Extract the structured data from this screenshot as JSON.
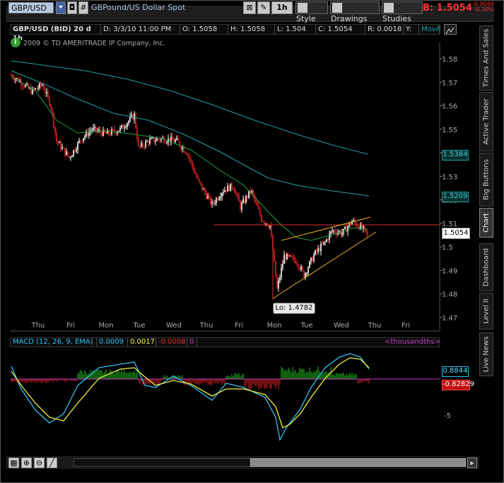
{
  "toolbar": {
    "symbol": "GBP/USD",
    "description": "GBPound/US Dollar Spot",
    "timeframe": "1h",
    "style_label": "Style",
    "drawings_label": "Drawings",
    "studies_label": "Studies",
    "last_prefix": "B:",
    "last_price": "1.5054",
    "change": "-0.0046",
    "change_pct": "-0.30%"
  },
  "header": {
    "title": "GBP/USD (BID) 20 d 1h",
    "date": "D: 3/3/10 11:00 PM",
    "open": "O: 1.5058",
    "high": "H: 1.5058",
    "low": "L: 1.504",
    "close": "C: 1.5054",
    "range": "R: 0.0018",
    "y": "Y:",
    "study": "MovAvgExponen..."
  },
  "copyright": "2009 © TD AMERITRADE IP Company, Inc.",
  "side_tabs": [
    "Times And Sales",
    "Active Trader",
    "Big Buttons",
    "Chart",
    "Dashboard",
    "Level II",
    "Live News"
  ],
  "price_axis": {
    "ticks": [
      "1.58",
      "1.57",
      "1.56",
      "1.55",
      "1.54",
      "1.53",
      "1.52",
      "1.51",
      "1.5",
      "1.49",
      "1.48",
      "1.47"
    ],
    "ema_long_label": "1.5384",
    "ema_mid_label": "1.5209",
    "last_label": "1.5054",
    "low_label": "Lo: 1.4782"
  },
  "time_axis": [
    "Thu",
    "Fri",
    "Mon",
    "Tue",
    "Wed",
    "Thu",
    "Fri",
    "Mon",
    "Tue",
    "Wed",
    "Thu",
    "Fri"
  ],
  "macd": {
    "title": "MACD (12, 26, 9, EMA)",
    "value": "0.0009",
    "avg": "0.0017",
    "diff": "-0.0008",
    "zero": "0",
    "units": "<thousandths>",
    "value_label": "0.8844",
    "diff_label": "-0.82829",
    "tick_label": "-5"
  },
  "colors": {
    "up_candle": "#ffffff",
    "down_candle": "#e02020",
    "ema_long": "#20a0a0",
    "ema_mid": "#20a0a0",
    "ema_short": "#20a040",
    "trend": "#f0b020",
    "resistance": "#e03030",
    "macd_value": "#30c0f0",
    "macd_avg": "#f0f040",
    "macd_pos": "#20c020",
    "macd_neg": "#e02020",
    "zero_line": "#c040c0"
  }
}
